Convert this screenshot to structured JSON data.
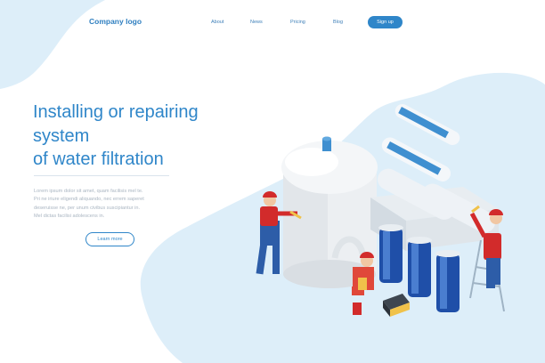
{
  "header": {
    "logo": "Company logo",
    "nav": [
      "About",
      "News",
      "Pricing",
      "Blog"
    ],
    "signup": "Sign up"
  },
  "hero": {
    "headline": [
      "Installing or repairing",
      "system",
      "of water filtration"
    ],
    "body": [
      "Lorem ipsum dolor sit amet, quam facilisis mel te.",
      "Pri ne iriure eligendi aliquando, nec errem saperet",
      "deseruisse ne, per unum civibus suscipiantur in.",
      "Mel dictas facilisi adolescens in."
    ],
    "cta": "Learn more"
  },
  "colors": {
    "accent": "#2f86c9",
    "blob": "#ddeef9",
    "text_muted": "#a9b5c1"
  }
}
